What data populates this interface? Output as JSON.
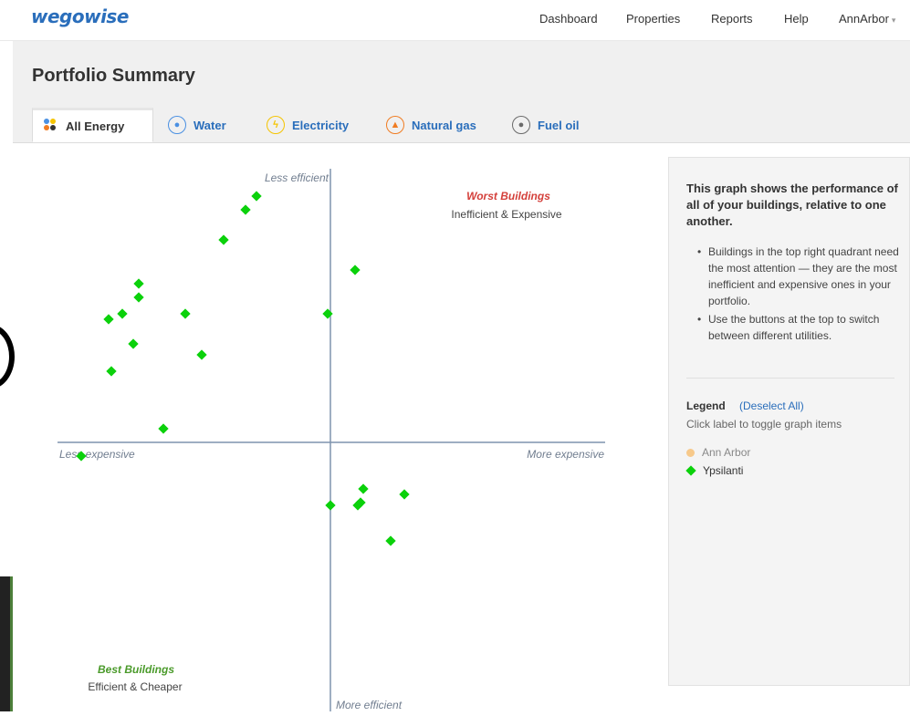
{
  "app": {
    "logo": "wegowise"
  },
  "nav": {
    "dashboard": "Dashboard",
    "properties": "Properties",
    "reports": "Reports",
    "help": "Help",
    "account": "AnnArbor"
  },
  "page": {
    "title": "Portfolio Summary"
  },
  "tabs": [
    {
      "label": "All Energy",
      "icon": "all-energy-icon",
      "color": "#333333"
    },
    {
      "label": "Water",
      "icon": "water-drop-icon",
      "color": "#4a90e2"
    },
    {
      "label": "Electricity",
      "icon": "lightning-bolt-icon",
      "color": "#f5c400"
    },
    {
      "label": "Natural gas",
      "icon": "flame-icon",
      "color": "#f07c22"
    },
    {
      "label": "Fuel oil",
      "icon": "oil-drop-icon",
      "color": "#6a6a6a"
    }
  ],
  "chart": {
    "quadrants": {
      "top_axis": "Less efficient",
      "bottom_axis": "More efficient",
      "left_axis": "Less expensive",
      "right_axis": "More expensive",
      "worst_title": "Worst Buildings",
      "worst_subtitle": "Inefficient & Expensive",
      "best_title": "Best Buildings",
      "best_subtitle": "Efficient & Cheaper"
    },
    "colors": {
      "worst": "#d43f3a",
      "best": "#4a9a2a",
      "axis": "#7f94ad",
      "point": "#0bd10b"
    }
  },
  "chart_data": {
    "type": "scatter",
    "xlabel": "",
    "ylabel": "",
    "xlim": [
      -100,
      100
    ],
    "ylim": [
      -100,
      100
    ],
    "grid": false,
    "series": [
      {
        "name": "Ypsilanti",
        "points": [
          [
            -27,
            90
          ],
          [
            -31,
            85
          ],
          [
            -39,
            74
          ],
          [
            9,
            63
          ],
          [
            -70,
            58
          ],
          [
            -70,
            53
          ],
          [
            -53,
            47
          ],
          [
            -76,
            47
          ],
          [
            -81,
            45
          ],
          [
            -1,
            47
          ],
          [
            -72,
            36
          ],
          [
            -47,
            32
          ],
          [
            -80,
            26
          ],
          [
            -61,
            5
          ],
          [
            -91,
            -5
          ],
          [
            12,
            -17
          ],
          [
            27,
            -19
          ],
          [
            11,
            -22
          ],
          [
            10,
            -23
          ],
          [
            0,
            -23
          ],
          [
            22,
            -36
          ]
        ]
      }
    ]
  },
  "panel": {
    "heading": "This graph shows the performance of all of your buildings, relative to one another.",
    "bullets": [
      "Buildings in the top right quadrant need the most attention — they are the most inefficient and expensive ones in your portfolio.",
      "Use the buttons at the top to switch between different utilities."
    ],
    "legend_title": "Legend",
    "deselect_label": "(Deselect All)",
    "legend_hint": "Click label to toggle graph items",
    "legend_items": [
      {
        "label": "Ann Arbor",
        "color": "#f7c98a",
        "shape": "circle"
      },
      {
        "label": "Ypsilanti",
        "color": "#0bd10b",
        "shape": "diamond"
      }
    ]
  }
}
